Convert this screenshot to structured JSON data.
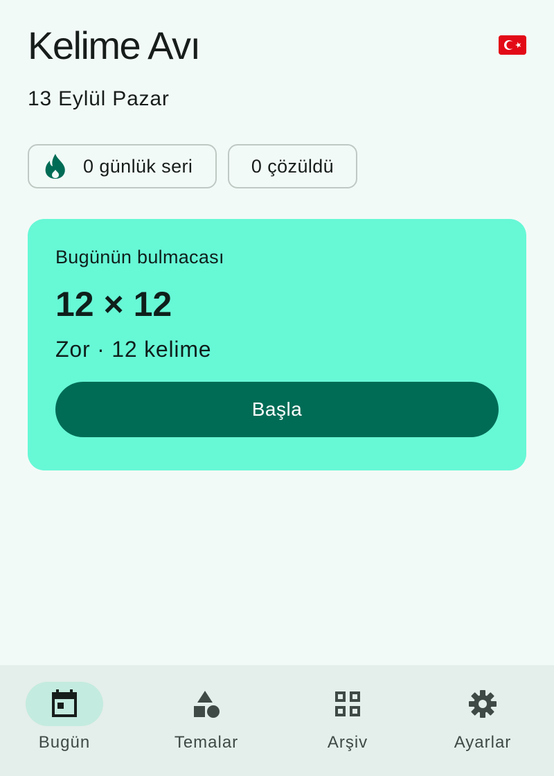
{
  "header": {
    "title": "Kelime Avı",
    "language_flag": "turkey-flag-icon"
  },
  "date": "13 Eylül Pazar",
  "stats": {
    "streak_label": "0 günlük seri",
    "streak_icon": "flame-icon",
    "solved_label": "0 çözüldü"
  },
  "puzzle": {
    "label": "Bugünün bulmacası",
    "size": "12 × 12",
    "info": "Zor · 12 kelime",
    "start_label": "Başla"
  },
  "nav": {
    "items": [
      {
        "label": "Bugün",
        "icon": "calendar-icon",
        "active": true
      },
      {
        "label": "Temalar",
        "icon": "shapes-icon",
        "active": false
      },
      {
        "label": "Arşiv",
        "icon": "grid-icon",
        "active": false
      },
      {
        "label": "Ayarlar",
        "icon": "gear-icon",
        "active": false
      }
    ]
  },
  "colors": {
    "background": "#f2faf7",
    "card": "#67f8d6",
    "accent": "#006c56",
    "navbar": "#e4eeea",
    "active_pill": "#c4ebdf",
    "flag_red": "#e30a17"
  }
}
